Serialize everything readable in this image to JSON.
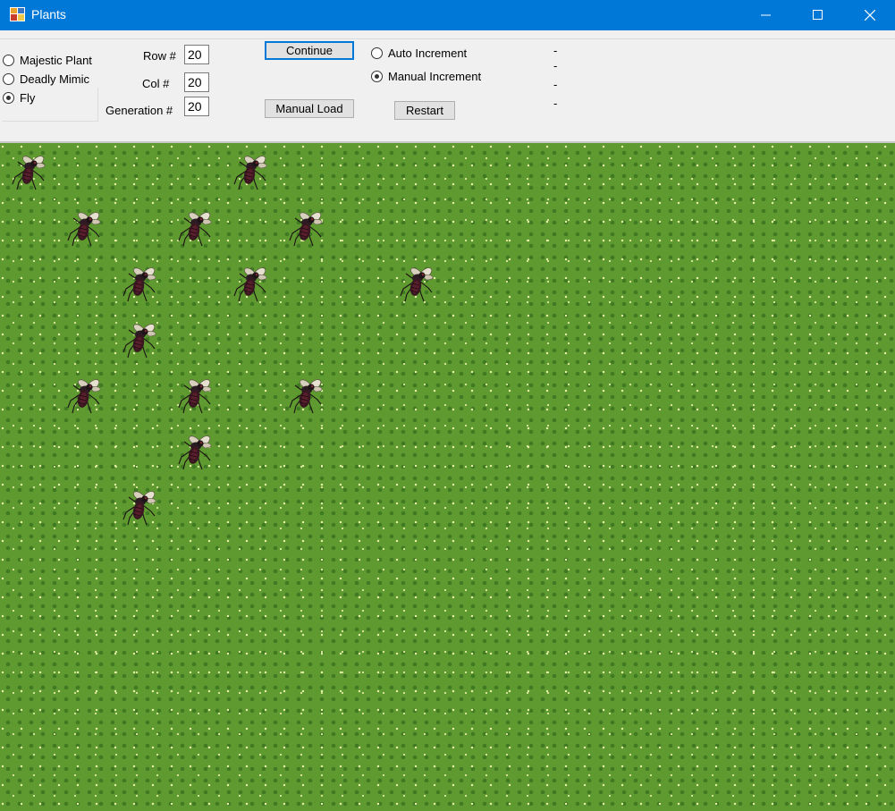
{
  "window": {
    "title": "Plants",
    "controls": {
      "minimize": "minimize-icon",
      "maximize": "maximize-icon",
      "close": "close-icon"
    }
  },
  "species": {
    "options": [
      {
        "label": "Majestic Plant",
        "checked": false
      },
      {
        "label": "Deadly Mimic",
        "checked": false
      },
      {
        "label": "Fly",
        "checked": true
      }
    ]
  },
  "grid_settings": {
    "row_label": "Row #",
    "row_value": "20",
    "col_label": "Col #",
    "col_value": "20",
    "generation_label": "Generation #",
    "generation_value": "20"
  },
  "buttons": {
    "continue": "Continue",
    "manual_load": "Manual Load",
    "restart": "Restart"
  },
  "increment_mode": {
    "options": [
      {
        "label": "Auto Increment",
        "checked": false
      },
      {
        "label": "Manual Increment",
        "checked": true
      }
    ]
  },
  "status_lines": [
    "-",
    "-",
    "-",
    "-"
  ],
  "board": {
    "rows": 20,
    "cols": 20,
    "flies": [
      {
        "row": 0,
        "col": 0
      },
      {
        "row": 0,
        "col": 4
      },
      {
        "row": 1,
        "col": 1
      },
      {
        "row": 1,
        "col": 3
      },
      {
        "row": 1,
        "col": 5
      },
      {
        "row": 2,
        "col": 2
      },
      {
        "row": 2,
        "col": 4
      },
      {
        "row": 2,
        "col": 7
      },
      {
        "row": 3,
        "col": 2
      },
      {
        "row": 4,
        "col": 1
      },
      {
        "row": 4,
        "col": 3
      },
      {
        "row": 4,
        "col": 5
      },
      {
        "row": 5,
        "col": 3
      },
      {
        "row": 6,
        "col": 2
      }
    ]
  },
  "colors": {
    "titlebar": "#0078d7",
    "grass": "#5f9a31",
    "focus_border": "#0078d7"
  }
}
